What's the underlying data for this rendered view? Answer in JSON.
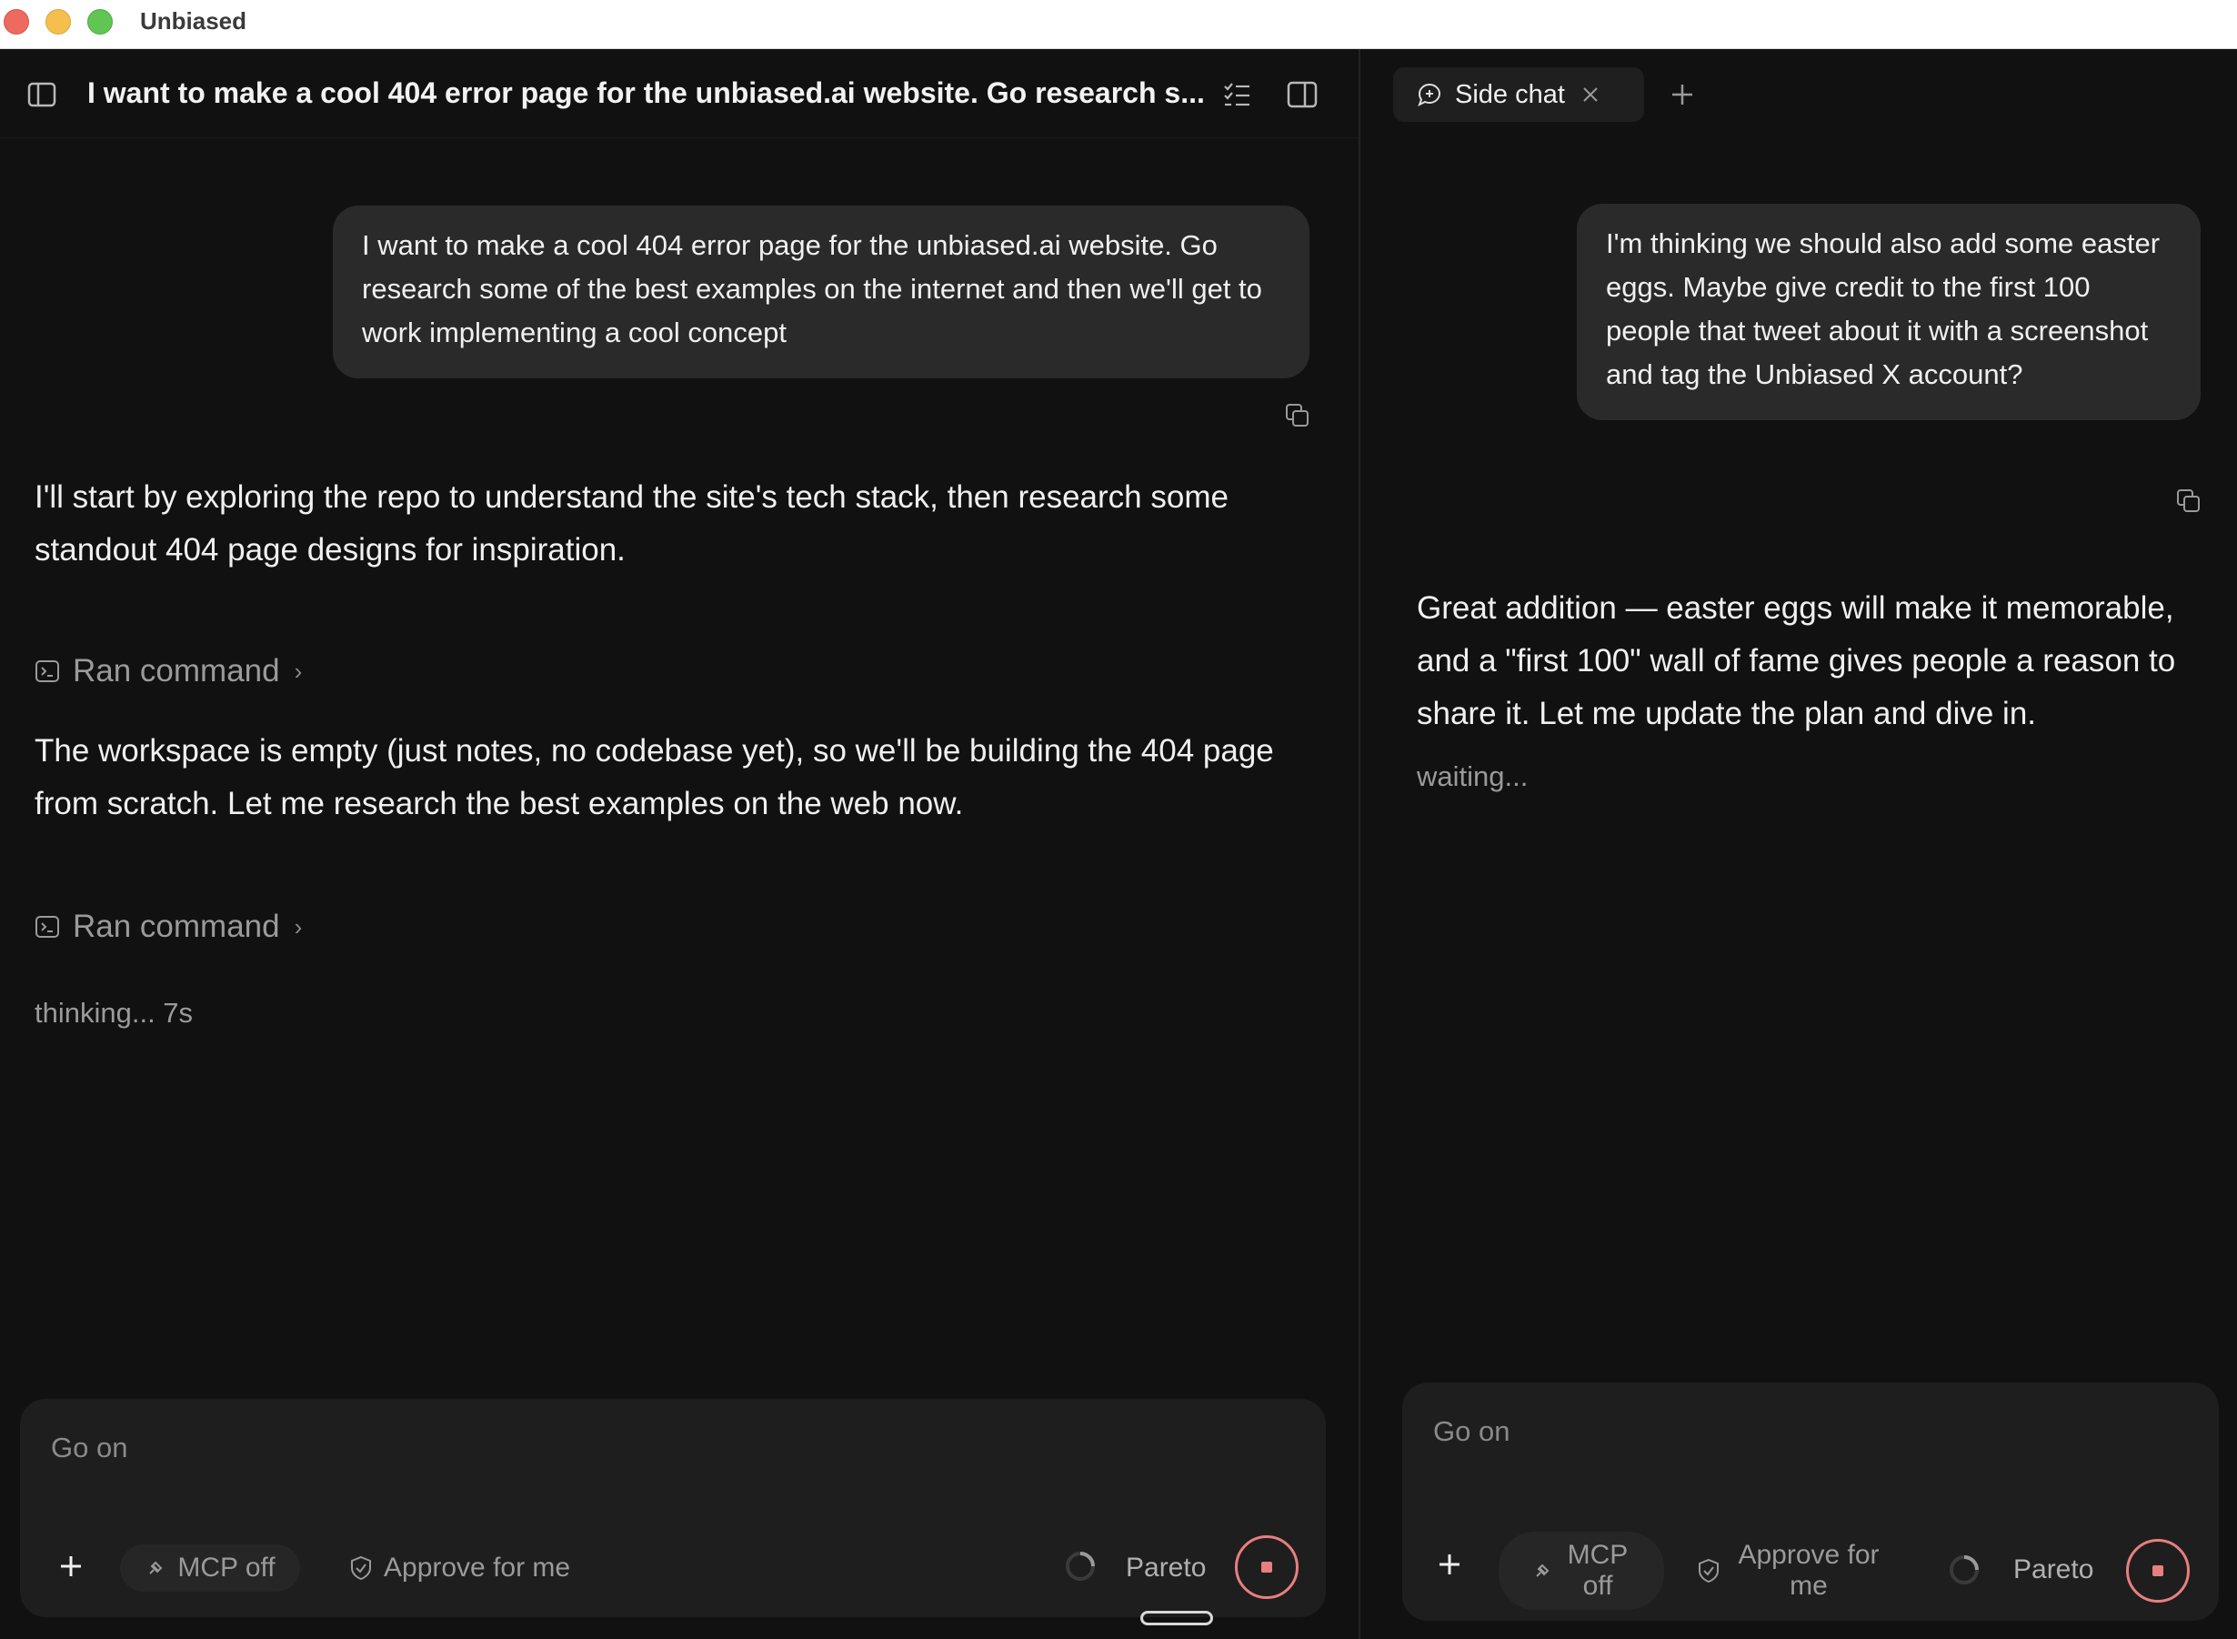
{
  "window": {
    "app_title": "Unbiased"
  },
  "main": {
    "header_title": "I want to make a cool 404 error page for the unbiased.ai website. Go research s...",
    "user_message": "I want to make a cool 404 error page for the unbiased.ai website. Go research some of the best examples on the internet and then we'll get to work implementing a cool concept",
    "assistant_message_1": "I'll start by exploring the repo to understand the site's tech stack, then research some standout 404 page designs for inspiration.",
    "ran_command_1": "Ran command",
    "assistant_message_2": "The workspace is empty (just notes, no codebase yet), so we'll be building the 404 page from scratch. Let me research the best examples on the web now.",
    "ran_command_2": "Ran command",
    "status": "thinking... 7s",
    "composer": {
      "placeholder": "Go on",
      "mcp_label": "MCP off",
      "approve_label": "Approve for me",
      "model_label": "Pareto"
    }
  },
  "side": {
    "tab_label": "Side chat",
    "user_message": "I'm thinking we should also add some easter eggs. Maybe give credit to the first 100 people that tweet about it with a screenshot and tag the Unbiased X account?",
    "assistant_message": "Great addition — easter eggs will make it memorable, and a \"first 100\" wall of fame gives people a reason to share it. Let me update the plan and dive in.",
    "status": "waiting...",
    "composer": {
      "placeholder": "Go on",
      "mcp_label": "MCP off",
      "approve_label": "Approve for me",
      "model_label": "Pareto"
    }
  },
  "colors": {
    "accent_stop": "#e87f7f",
    "background": "#111111",
    "bubble": "#2a2a2a"
  }
}
